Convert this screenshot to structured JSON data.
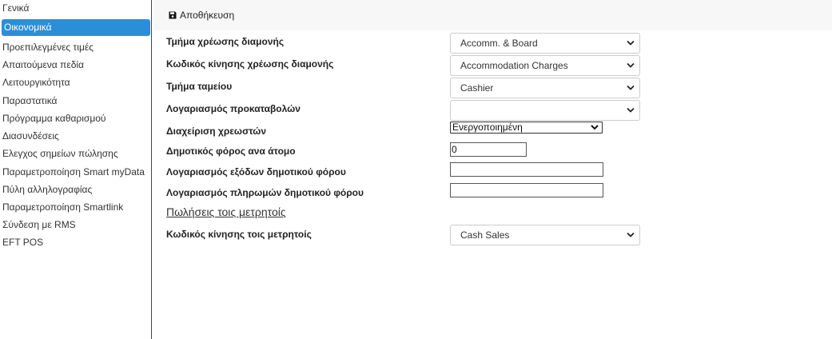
{
  "sidebar": {
    "items": [
      {
        "label": "Γενικά",
        "active": false
      },
      {
        "label": "Οικονομικά",
        "active": true
      },
      {
        "label": "Προεπιλεγμένες τιμές",
        "active": false
      },
      {
        "label": "Απαιτούμενα πεδία",
        "active": false
      },
      {
        "label": "Λειτουργικότητα",
        "active": false
      },
      {
        "label": "Παραστατικά",
        "active": false
      },
      {
        "label": "Πρόγραμμα καθαρισμού",
        "active": false
      },
      {
        "label": "Διασυνδέσεις",
        "active": false
      },
      {
        "label": "Ελεγχος σημείων πώλησης",
        "active": false
      },
      {
        "label": "Παραμετροποίηση Smart myData",
        "active": false
      },
      {
        "label": "Πύλη αλληλογραφίας",
        "active": false
      },
      {
        "label": "Παραμετροποίηση Smartlink",
        "active": false
      },
      {
        "label": "Σύνδεση με RMS",
        "active": false
      },
      {
        "label": "EFT POS",
        "active": false
      }
    ],
    "active_color": "#2a8fd8"
  },
  "toolbar": {
    "save_label": "Αποθήκευση",
    "save_icon": "floppy-disk-icon"
  },
  "form": {
    "fields": [
      {
        "label": "Τμήμα χρέωσης διαμονής",
        "value": "Accomm. & Board"
      },
      {
        "label": "Κωδικός κίνησης χρέωσης διαμονής",
        "value": "Accommodation Charges"
      },
      {
        "label": "Τμήμα ταμείου",
        "value": "Cashier"
      },
      {
        "label": "Λογαριασμός προκαταβολών",
        "value": ""
      },
      {
        "label": "Διαχείριση χρεωστών",
        "value": "Ενεργοποιημένη"
      },
      {
        "label": "Δημοτικός φόρος ανα άτομο",
        "value": "0"
      },
      {
        "label": "Λογαριασμός εξόδων δημοτικού φόρου",
        "value": ""
      },
      {
        "label": "Λογαριασμός πληρωμών δημοτικού φόρου",
        "value": ""
      }
    ],
    "section_title": "Πωλήσεις τοις μετρητοίς",
    "cash_field": {
      "label": "Κωδικός κίνησης τοις μετρητοίς",
      "value": "Cash Sales"
    }
  }
}
